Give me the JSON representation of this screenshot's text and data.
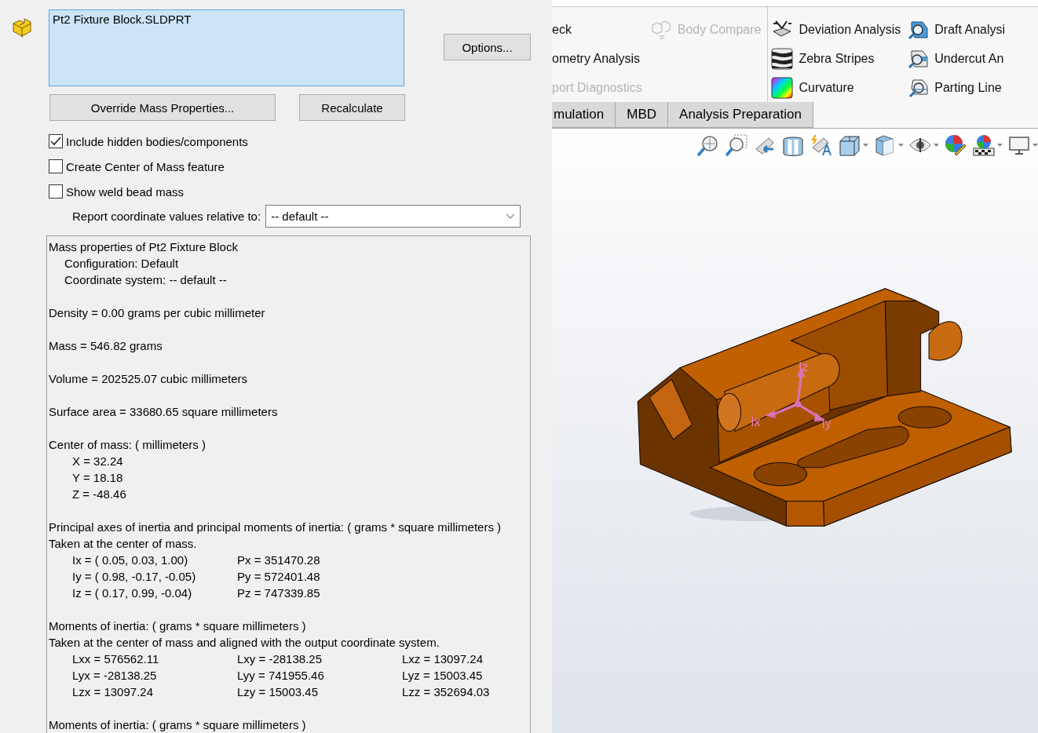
{
  "dialog": {
    "selection": {
      "items": [
        "Pt2 Fixture Block.SLDPRT"
      ]
    },
    "buttons": [
      {
        "kind": "options",
        "label": "Options..."
      },
      {
        "kind": "override",
        "label": "Override Mass Properties..."
      },
      {
        "kind": "recalc",
        "label": "Recalculate"
      }
    ],
    "checkboxes": [
      {
        "label": "Include hidden bodies/components",
        "checked": true
      },
      {
        "label": "Create Center of Mass feature",
        "checked": false
      },
      {
        "label": "Show weld bead mass",
        "checked": false
      }
    ],
    "coord_label": "Report coordinate values relative to:",
    "coord_value": "-- default --",
    "report": [
      {
        "kind": "text",
        "text": "Mass properties of Pt2 Fixture Block"
      },
      {
        "kind": "indent",
        "text": "Configuration: Default"
      },
      {
        "kind": "indent",
        "text": "Coordinate system: -- default --"
      },
      {
        "kind": "blank"
      },
      {
        "kind": "text",
        "text": "Density = 0.00 grams per cubic millimeter"
      },
      {
        "kind": "blank"
      },
      {
        "kind": "text",
        "text": "Mass = 546.82 grams"
      },
      {
        "kind": "blank"
      },
      {
        "kind": "text",
        "text": "Volume = 202525.07 cubic millimeters"
      },
      {
        "kind": "blank"
      },
      {
        "kind": "text",
        "text": "Surface area = 33680.65  square millimeters"
      },
      {
        "kind": "blank"
      },
      {
        "kind": "text",
        "text": "Center of mass: ( millimeters )"
      },
      {
        "kind": "value",
        "text": "X = 32.24"
      },
      {
        "kind": "value",
        "text": "Y = 18.18"
      },
      {
        "kind": "value",
        "text": "Z = -48.46"
      },
      {
        "kind": "blank"
      },
      {
        "kind": "text",
        "text": "Principal axes of inertia and principal moments of inertia: ( grams *  square millimeters )"
      },
      {
        "kind": "text",
        "text": "Taken at the center of mass."
      },
      {
        "kind": "row",
        "cells": [
          "Ix = ( 0.05,  0.03,  1.00)",
          "Px = 351470.28"
        ]
      },
      {
        "kind": "row",
        "cells": [
          "Iy = ( 0.98, -0.17, -0.05)",
          "Py = 572401.48"
        ]
      },
      {
        "kind": "row",
        "cells": [
          "Iz = ( 0.17,  0.99, -0.04)",
          "Pz = 747339.85"
        ]
      },
      {
        "kind": "blank"
      },
      {
        "kind": "text",
        "text": "Moments of inertia: ( grams *  square millimeters )"
      },
      {
        "kind": "text",
        "text": "Taken at the center of mass and aligned with the output coordinate system."
      },
      {
        "kind": "row",
        "cells": [
          "Lxx = 576562.11",
          "Lxy = -28138.25",
          "Lxz = 13097.24"
        ]
      },
      {
        "kind": "row",
        "cells": [
          "Lyx = -28138.25",
          "Lyy = 741955.46",
          "Lyz = 15003.45"
        ]
      },
      {
        "kind": "row",
        "cells": [
          "Lzx = 13097.24",
          "Lzy = 15003.45",
          "Lzz = 352694.03"
        ]
      },
      {
        "kind": "blank"
      },
      {
        "kind": "text",
        "text": "Moments of inertia: ( grams *  square millimeters )"
      }
    ]
  },
  "ribbon": {
    "columns": [
      [
        {
          "label": "eck",
          "disabled": false
        },
        {
          "label": "ometry Analysis",
          "disabled": false
        },
        {
          "label": "port Diagnostics",
          "disabled": true
        }
      ],
      [
        {
          "label": "Body Compare",
          "disabled": true
        }
      ],
      [
        {
          "label": "Deviation Analysis",
          "disabled": false
        },
        {
          "label": "Zebra Stripes",
          "disabled": false
        },
        {
          "label": "Curvature",
          "disabled": false
        }
      ],
      [
        {
          "label": "Draft Analysi",
          "disabled": false
        },
        {
          "label": "Undercut An",
          "disabled": false
        },
        {
          "label": "Parting Line",
          "disabled": false
        }
      ]
    ]
  },
  "tabs": [
    {
      "label": "mulation",
      "selected": false
    },
    {
      "label": "MBD",
      "selected": false
    },
    {
      "label": "Analysis Preparation",
      "selected": false
    }
  ],
  "view_toolbar": [
    {
      "dropdown": false
    },
    {
      "dropdown": false
    },
    {
      "dropdown": false
    },
    {
      "dropdown": false
    },
    {
      "dropdown": false
    },
    {
      "dropdown": true
    },
    {
      "dropdown": true
    },
    {
      "dropdown": true
    },
    {
      "dropdown": false
    },
    {
      "dropdown": true
    },
    {
      "dropdown": true
    }
  ],
  "viewport": {
    "triad": [
      "Ix",
      "Iy",
      "Iz"
    ]
  }
}
